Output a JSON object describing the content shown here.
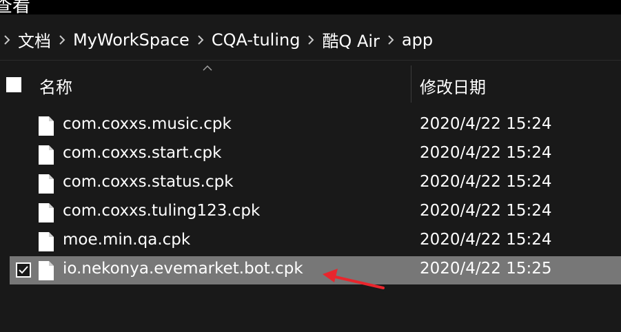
{
  "window": {
    "title": "查看"
  },
  "breadcrumb": {
    "items": [
      "文档",
      "MyWorkSpace",
      "CQA-tuling",
      "酷Q Air",
      "app"
    ]
  },
  "columns": {
    "name": "名称",
    "date_modified": "修改日期"
  },
  "files": [
    {
      "name": "com.coxxs.music.cpk",
      "date": "2020/4/22 15:24",
      "selected": false
    },
    {
      "name": "com.coxxs.start.cpk",
      "date": "2020/4/22 15:24",
      "selected": false
    },
    {
      "name": "com.coxxs.status.cpk",
      "date": "2020/4/22 15:24",
      "selected": false
    },
    {
      "name": "com.coxxs.tuling123.cpk",
      "date": "2020/4/22 15:24",
      "selected": false
    },
    {
      "name": "moe.min.qa.cpk",
      "date": "2020/4/22 15:24",
      "selected": false
    },
    {
      "name": "io.nekonya.evemarket.bot.cpk",
      "date": "2020/4/22 15:25",
      "selected": true
    }
  ],
  "colors": {
    "background": "#191919",
    "selected_row": "#777777",
    "annotation_arrow": "#e8262d"
  },
  "icons": {
    "breadcrumb_separator": "chevron-right-icon",
    "file": "document-icon",
    "sort": "chevron-up-icon",
    "annotation": "red-arrow"
  }
}
